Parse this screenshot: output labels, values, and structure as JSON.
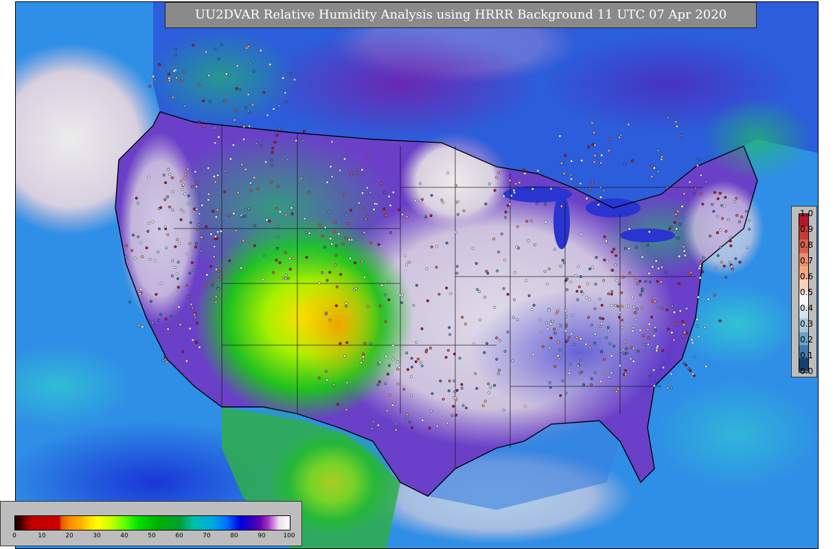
{
  "title": "UU2DVAR Relative Humidity Analysis using HRRR Background 11 UTC 07 Apr 2020",
  "obs_legend": {
    "ticks": [
      "1.0",
      "0.9",
      "0.8",
      "0.7",
      "0.6",
      "0.5",
      "0.4",
      "0.3",
      "0.2",
      "0.1",
      "0.0"
    ],
    "colors": [
      "#b2182b",
      "#c53a38",
      "#d6604d",
      "#ea9070",
      "#f4a582",
      "#f7d0bf",
      "#f7f7f7",
      "#d6e3ea",
      "#a8c6d6",
      "#6ea3c5",
      "#3f79ad",
      "#163f70"
    ]
  },
  "rh_legend": {
    "ticks": [
      "0",
      "10",
      "20",
      "30",
      "40",
      "50",
      "60",
      "70",
      "80",
      "90",
      "100"
    ]
  }
}
